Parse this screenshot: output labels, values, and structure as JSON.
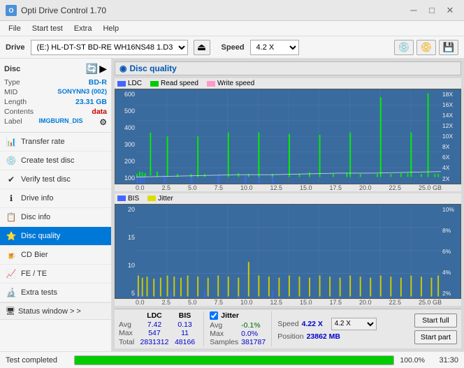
{
  "titlebar": {
    "title": "Opti Drive Control 1.70",
    "icon_char": "O",
    "minimize": "─",
    "maximize": "□",
    "close": "✕"
  },
  "menubar": {
    "items": [
      "File",
      "Start test",
      "Extra",
      "Help"
    ]
  },
  "drivebar": {
    "label": "Drive",
    "drive_value": "(E:)  HL-DT-ST BD-RE  WH16NS48 1.D3",
    "speed_label": "Speed",
    "speed_value": "4.2 X"
  },
  "disc": {
    "title": "Disc",
    "type_label": "Type",
    "type_value": "BD-R",
    "mid_label": "MID",
    "mid_value": "SONYNN3 (002)",
    "length_label": "Length",
    "length_value": "23.31 GB",
    "contents_label": "Contents",
    "contents_value": "data",
    "label_label": "Label",
    "label_value": "IMGBURN_DIS"
  },
  "nav": {
    "items": [
      {
        "id": "transfer-rate",
        "label": "Transfer rate",
        "icon": "📊"
      },
      {
        "id": "create-test-disc",
        "label": "Create test disc",
        "icon": "💿"
      },
      {
        "id": "verify-test-disc",
        "label": "Verify test disc",
        "icon": "✔"
      },
      {
        "id": "drive-info",
        "label": "Drive info",
        "icon": "ℹ"
      },
      {
        "id": "disc-info",
        "label": "Disc info",
        "icon": "📋"
      },
      {
        "id": "disc-quality",
        "label": "Disc quality",
        "icon": "⭐",
        "active": true
      },
      {
        "id": "cd-bier",
        "label": "CD Bier",
        "icon": "🍺"
      },
      {
        "id": "fe-te",
        "label": "FE / TE",
        "icon": "📈"
      },
      {
        "id": "extra-tests",
        "label": "Extra tests",
        "icon": "🔬"
      }
    ],
    "status_window": "Status window > >"
  },
  "disc_quality": {
    "title": "Disc quality",
    "legend": {
      "ldc_label": "LDC",
      "read_speed_label": "Read speed",
      "write_speed_label": "Write speed"
    },
    "chart1": {
      "y_axis": [
        "600",
        "500",
        "400",
        "300",
        "200",
        "100"
      ],
      "y_axis_right": [
        "18X",
        "16X",
        "14X",
        "12X",
        "10X",
        "8X",
        "6X",
        "4X",
        "2X"
      ],
      "x_axis": [
        "0.0",
        "2.5",
        "5.0",
        "7.5",
        "10.0",
        "12.5",
        "15.0",
        "17.5",
        "20.0",
        "22.5",
        "25.0 GB"
      ]
    },
    "legend2": {
      "bis_label": "BIS",
      "jitter_label": "Jitter"
    },
    "chart2": {
      "y_axis": [
        "20",
        "15",
        "10",
        "5"
      ],
      "y_axis_right": [
        "10%",
        "8%",
        "6%",
        "4%",
        "2%"
      ],
      "x_axis": [
        "0.0",
        "2.5",
        "5.0",
        "7.5",
        "10.0",
        "12.5",
        "15.0",
        "17.5",
        "20.0",
        "22.5",
        "25.0 GB"
      ]
    }
  },
  "stats": {
    "col_headers": [
      "LDC",
      "BIS"
    ],
    "rows": [
      {
        "label": "Avg",
        "ldc": "7.42",
        "bis": "0.13"
      },
      {
        "label": "Max",
        "ldc": "547",
        "bis": "11"
      },
      {
        "label": "Total",
        "ldc": "2831312",
        "bis": "48166"
      }
    ],
    "jitter": {
      "label": "Jitter",
      "checked": true,
      "rows": [
        {
          "label": "Avg",
          "val": "-0.1%"
        },
        {
          "label": "Max",
          "val": "0.0%"
        },
        {
          "label": "Samples",
          "val": "381787"
        }
      ]
    },
    "speed": {
      "label": "Speed",
      "value": "4.22 X",
      "select_value": "4.2 X",
      "position_label": "Position",
      "position_value": "23862 MB",
      "buttons": [
        "Start full",
        "Start part"
      ]
    }
  },
  "statusbar": {
    "text": "Test completed",
    "progress": "100.0%",
    "time": "31:30"
  }
}
